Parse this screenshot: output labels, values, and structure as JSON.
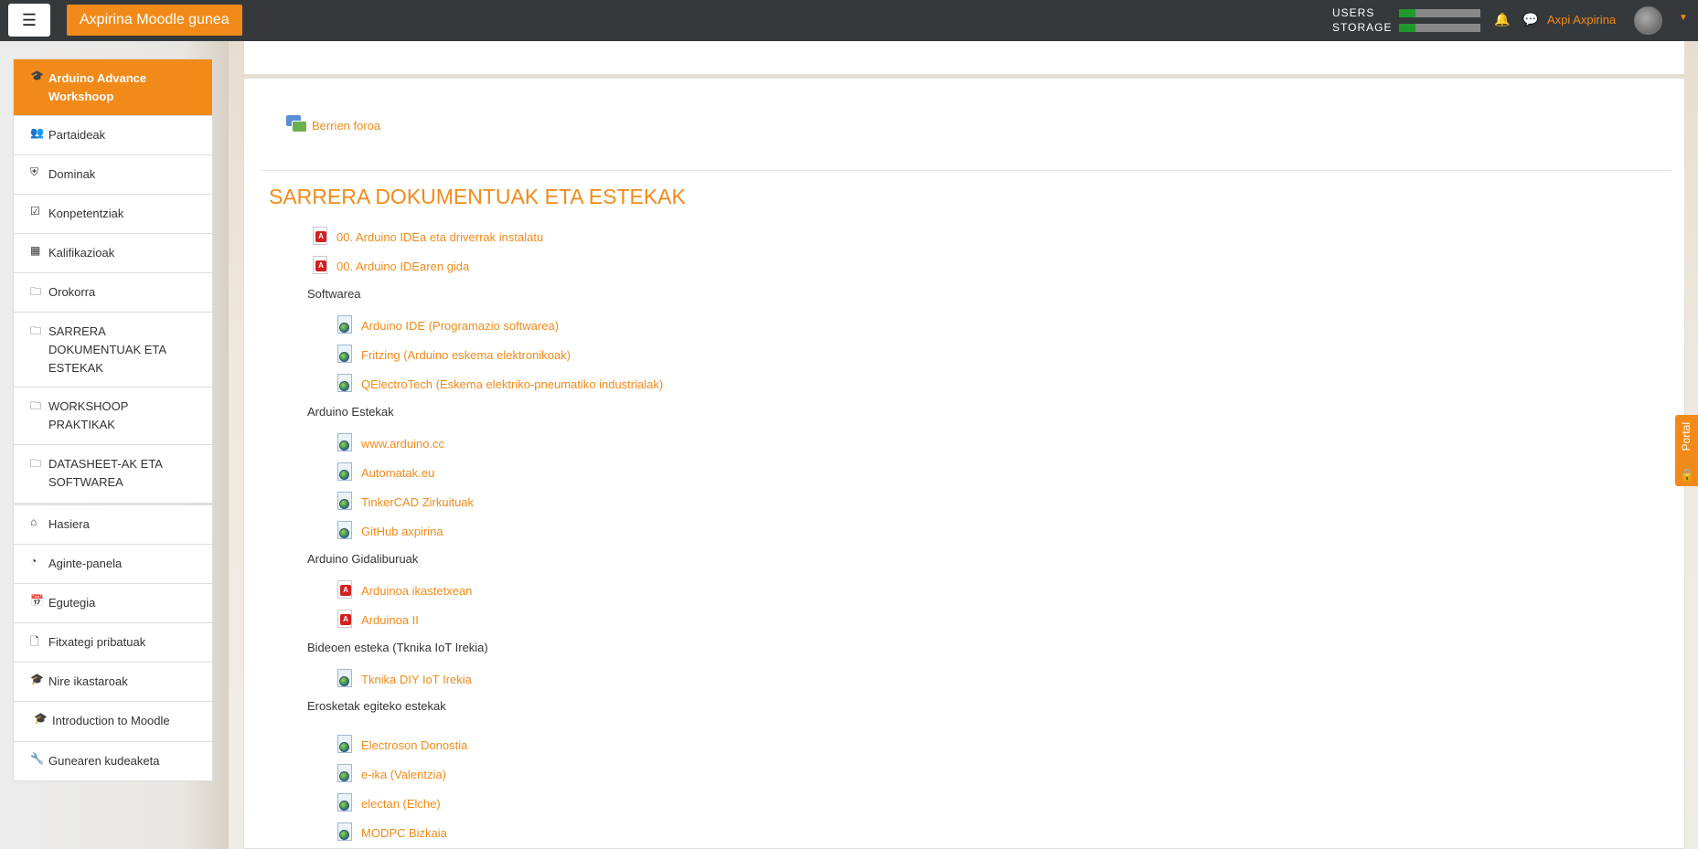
{
  "header": {
    "site_name": "Axpirina Moodle gunea",
    "quota": [
      {
        "label": "USERS",
        "fill_fraction": 0.2
      },
      {
        "label": "STORAGE",
        "fill_fraction": 0.2
      }
    ],
    "user_name": "Axpi Axpirina"
  },
  "sidebar": {
    "course": [
      {
        "label": "Arduino Advance Workshoop",
        "icon": "graduation-cap-icon",
        "active": true
      },
      {
        "label": "Partaideak",
        "icon": "users-icon"
      },
      {
        "label": "Dominak",
        "icon": "shield-icon"
      },
      {
        "label": "Konpetentziak",
        "icon": "checkbox-icon"
      },
      {
        "label": "Kalifikazioak",
        "icon": "table-icon"
      },
      {
        "label": "Orokorra",
        "icon": "folder-icon"
      },
      {
        "label": "SARRERA DOKUMENTUAK ETA ESTEKAK",
        "icon": "folder-icon"
      },
      {
        "label": "WORKSHOOP PRAKTIKAK",
        "icon": "folder-icon"
      },
      {
        "label": "DATASHEET-AK ETA SOFTWAREA",
        "icon": "folder-icon"
      }
    ],
    "site": [
      {
        "label": "Hasiera",
        "icon": "home-icon"
      },
      {
        "label": "Aginte-panela",
        "icon": "dashboard-icon"
      },
      {
        "label": "Egutegia",
        "icon": "calendar-icon"
      },
      {
        "label": "Fitxategi pribatuak",
        "icon": "file-icon"
      },
      {
        "label": "Nire ikastaroak",
        "icon": "graduation-cap-icon"
      },
      {
        "label": "Introduction to Moodle",
        "icon": "graduation-cap-icon"
      }
    ],
    "admin": [
      {
        "label": "Gunearen kudeaketa",
        "icon": "wrench-icon"
      }
    ]
  },
  "main": {
    "forum_link": "Berrien foroa",
    "section_title": "SARRERA DOKUMENTUAK ETA ESTEKAK",
    "pdf1": "00. Arduino IDEa eta driverrak instalatu",
    "pdf2": "00. Arduino IDEaren gida",
    "label_softwarea": "Softwarea",
    "soft1": "Arduino IDE (Programazio softwarea)",
    "soft2": "Fritzing (Arduino eskema elektronikoak)",
    "soft3": "QElectroTech (Eskema elektriko-pneumatiko industrialak)",
    "label_estekak": "Arduino Estekak",
    "link1": "www.arduino.cc",
    "link2": "Automatak.eu",
    "link3": "TinkerCAD Zirkuituak",
    "link4": "GitHub axpirina",
    "label_gidaliburuak": "Arduino Gidaliburuak",
    "guide1": "Arduinoa ikastetxean",
    "guide2": "Arduinoa II",
    "label_bideoak": "Bideoen esteka (Tknika IoT Irekia)",
    "video1": "Tknika DIY IoT Irekia",
    "label_erosketak": "Erosketak egiteko estekak",
    "shop1": "Electroson Donostia",
    "shop2": "e-ika (Valentzia)",
    "shop3": "electan (Elche)",
    "shop4": "MODPC Bizkaia"
  },
  "portal_tab": {
    "label": "Portal"
  },
  "colors": {
    "accent": "#f28a19",
    "navbar": "#35393b",
    "quota_fill": "#1e9a2a"
  }
}
